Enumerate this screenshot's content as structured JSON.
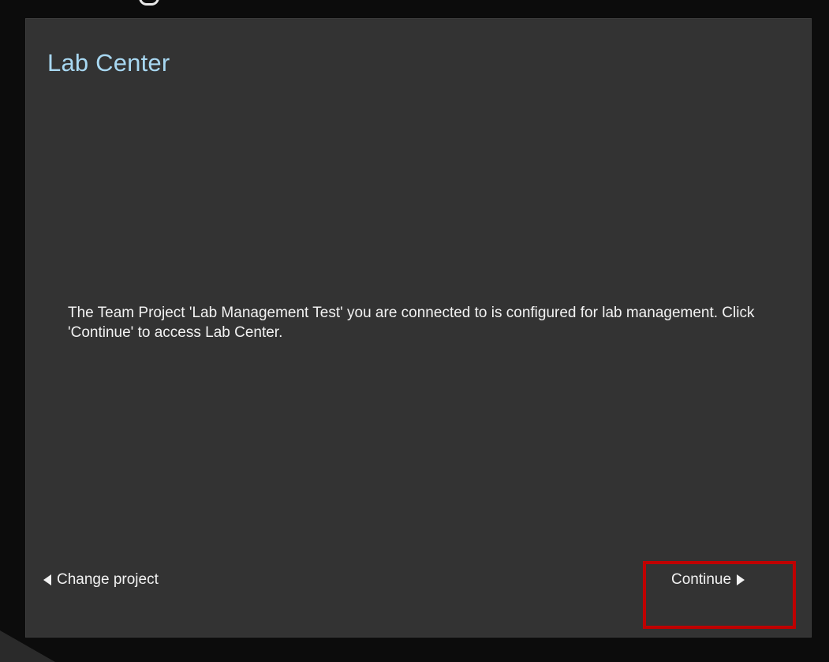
{
  "dialog": {
    "title": "Lab Center",
    "message": "The Team Project 'Lab Management Test' you are connected to is configured for lab management. Click 'Continue' to access Lab Center.",
    "back_label": "Change project",
    "back_icon": "triangle-left-icon",
    "continue_label": "Continue",
    "continue_icon": "triangle-right-icon"
  },
  "colors": {
    "panel_bg": "#333333",
    "title": "#a8d8f2",
    "text": "#f2f2f2",
    "highlight": "#c00000"
  }
}
